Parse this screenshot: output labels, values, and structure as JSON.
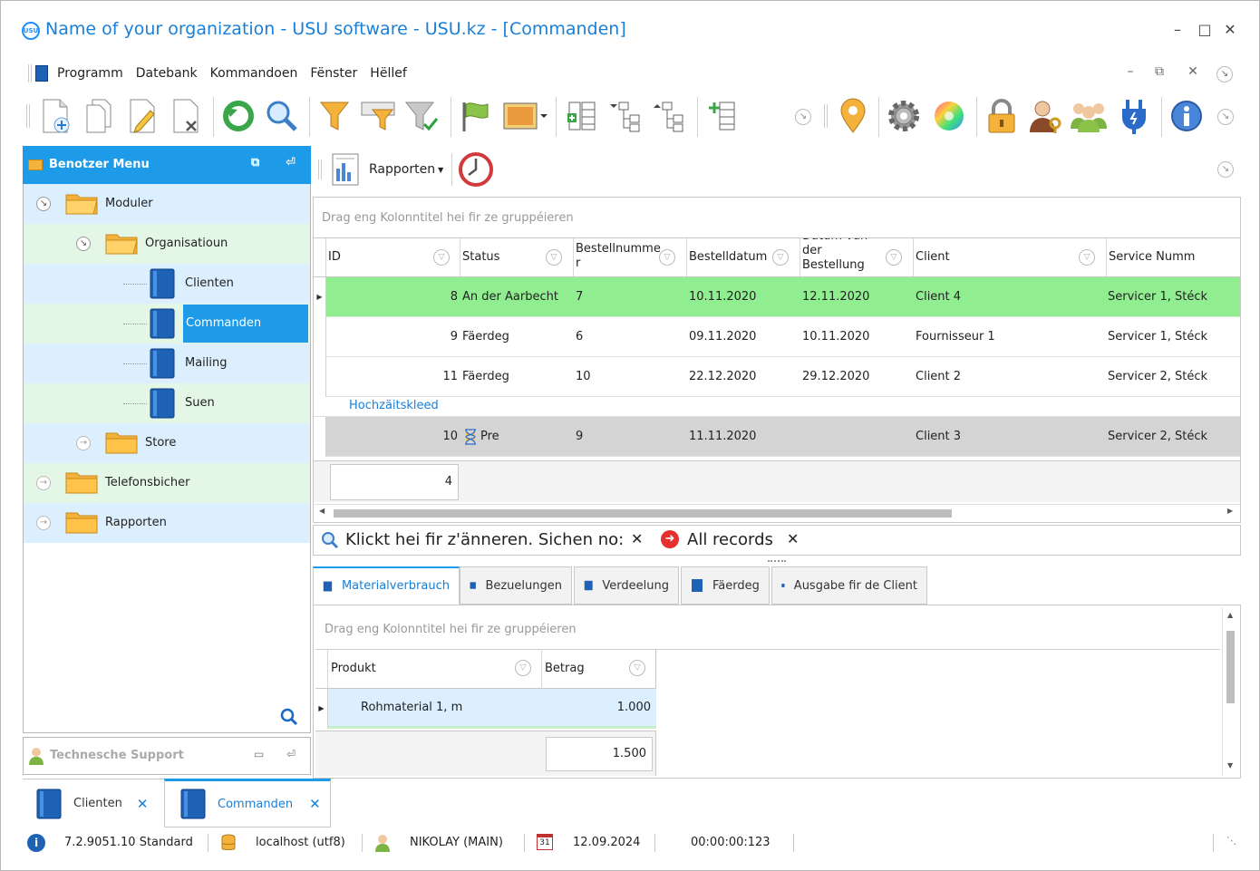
{
  "window": {
    "title": "Name of your organization - USU software - USU.kz - [Commanden]",
    "logo_text": "USU",
    "min_icon": "minimize-icon",
    "max_icon": "maximize-icon",
    "close_icon": "close-icon"
  },
  "menubar": {
    "items": [
      "Programm",
      "Datebank",
      "Kommandoen",
      "Fënster",
      "Hëllef"
    ]
  },
  "toolbar": {
    "icons": [
      "add-document-icon",
      "copy-document-icon",
      "edit-document-icon",
      "delete-document-icon",
      "refresh-icon",
      "search-icon",
      "filter-icon",
      "filter-columns-icon",
      "filter-clear-icon",
      "flag-icon",
      "picture-icon",
      "expand-rows-icon",
      "tree-collapse-icon",
      "tree-expand-icon",
      "add-column-icon",
      "location-pin-icon",
      "settings-icon",
      "color-wheel-icon",
      "lock-icon",
      "user-key-icon",
      "users-group-icon",
      "plug-icon",
      "info-icon"
    ]
  },
  "left_panel": {
    "title": "Benotzer Menu",
    "tree": [
      {
        "label": "Moduler",
        "level": 0,
        "kind": "folder",
        "state": "expanded"
      },
      {
        "label": "Organisatioun",
        "level": 1,
        "kind": "folder",
        "state": "expanded"
      },
      {
        "label": "Clienten",
        "level": 2,
        "kind": "book"
      },
      {
        "label": "Commanden",
        "level": 2,
        "kind": "book",
        "selected": true
      },
      {
        "label": "Mailing",
        "level": 2,
        "kind": "book"
      },
      {
        "label": "Suen",
        "level": 2,
        "kind": "book"
      },
      {
        "label": "Store",
        "level": 1,
        "kind": "folder",
        "state": "collapsed"
      },
      {
        "label": "Telefonsbicher",
        "level": 0,
        "kind": "folder",
        "state": "collapsed"
      },
      {
        "label": "Rapporten",
        "level": 0,
        "kind": "folder",
        "state": "collapsed"
      }
    ],
    "support_title": "Technesche Support"
  },
  "report_toolbar": {
    "reports_label": "Rapporten"
  },
  "grid": {
    "group_hint": "Drag eng Kolonntitel hei fir ze gruppéieren",
    "columns": [
      {
        "label": "ID"
      },
      {
        "label": "Status"
      },
      {
        "label": "Bestellnumme r"
      },
      {
        "label": "Bestelldatum"
      },
      {
        "label": "Datum vun der Bestellung"
      },
      {
        "label": "Client"
      },
      {
        "label": "Service Numm"
      }
    ],
    "rows": [
      {
        "id": "8",
        "status": "An der Aarbecht",
        "order_no": "7",
        "order_date": "10.11.2020",
        "delivery_date": "12.11.2020",
        "client": "Client 4",
        "service": "Servicer 1, Stéck"
      },
      {
        "id": "9",
        "status": "Fäerdeg",
        "order_no": "6",
        "order_date": "09.11.2020",
        "delivery_date": "10.11.2020",
        "client": "Fournisseur 1",
        "service": "Servicer 1, Stéck"
      },
      {
        "id": "11",
        "status": "Fäerdeg",
        "order_no": "10",
        "order_date": "22.12.2020",
        "delivery_date": "29.12.2020",
        "client": "Client 2",
        "service": "Servicer 2, Stéck"
      }
    ],
    "group_label": "Hochzäitskleed",
    "group_rows": [
      {
        "id": "10",
        "status": "Pre",
        "order_no": "9",
        "order_date": "11.11.2020",
        "delivery_date": "",
        "client": "Client 3",
        "service": "Servicer 2, Stéck"
      }
    ],
    "footer_count": "4"
  },
  "filter_bar": {
    "edit_text": "Klickt hei fir z'änneren. Sichen no:",
    "filter_value": "All records"
  },
  "detail_tabs": [
    "Materialverbrauch",
    "Bezuelungen",
    "Verdeelung",
    "Fäerdeg",
    "Ausgabe fir de Client"
  ],
  "detail_grid": {
    "group_hint": "Drag eng Kolonntitel hei fir ze gruppéieren",
    "columns": [
      "Produkt",
      "Betrag"
    ],
    "rows": [
      {
        "product": "Rohmaterial 1, m",
        "amount": "1.000"
      }
    ],
    "footer_sum": "1.500"
  },
  "bottom_tabs": [
    {
      "label": "Clienten",
      "active": false
    },
    {
      "label": "Commanden",
      "active": true
    }
  ],
  "status_bar": {
    "version": "7.2.9051.10 Standard",
    "database": "localhost (utf8)",
    "user": "NIKOLAY (MAIN)",
    "date": "12.09.2024",
    "calendar_day": "31",
    "timer": "00:00:00:123"
  },
  "colors": {
    "accent": "#1e9be8",
    "title_text": "#1a7fd6",
    "row_green": "#90ee90",
    "row_gray": "#d4d4d4",
    "tree_blue": "#dcefff",
    "tree_green": "#e4f6e6"
  }
}
